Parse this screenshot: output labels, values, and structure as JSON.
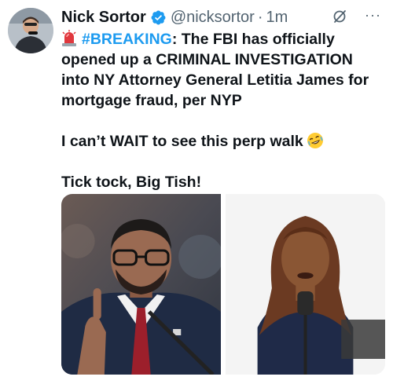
{
  "tweet": {
    "author_name": "Nick Sortor",
    "handle": "@nicksortor",
    "separator": "·",
    "time": "1m",
    "lines": {
      "l1_tag": "#BREAKING",
      "l1_rest": ": The FBI has officially",
      "l2": "opened up a CRIMINAL INVESTIGATION",
      "l3": "into NY Attorney General Letitia James for",
      "l4": "mortgage fraud, per NYP",
      "l5": "I can’t WAIT to see this perp walk",
      "l6": "Tick tock, Big Tish!"
    },
    "more_label": "···"
  },
  "icons": {
    "avatar": "avatar-photo",
    "verified": "verified-badge-icon",
    "grok": "grok-icon",
    "more": "more-options-icon",
    "siren": "police-light-emoji",
    "laugh": "rolling-laughing-emoji"
  },
  "colors": {
    "text": "#0f1419",
    "secondary": "#536471",
    "hashtag": "#1d9bf0",
    "verified": "#1d9bf0"
  }
}
